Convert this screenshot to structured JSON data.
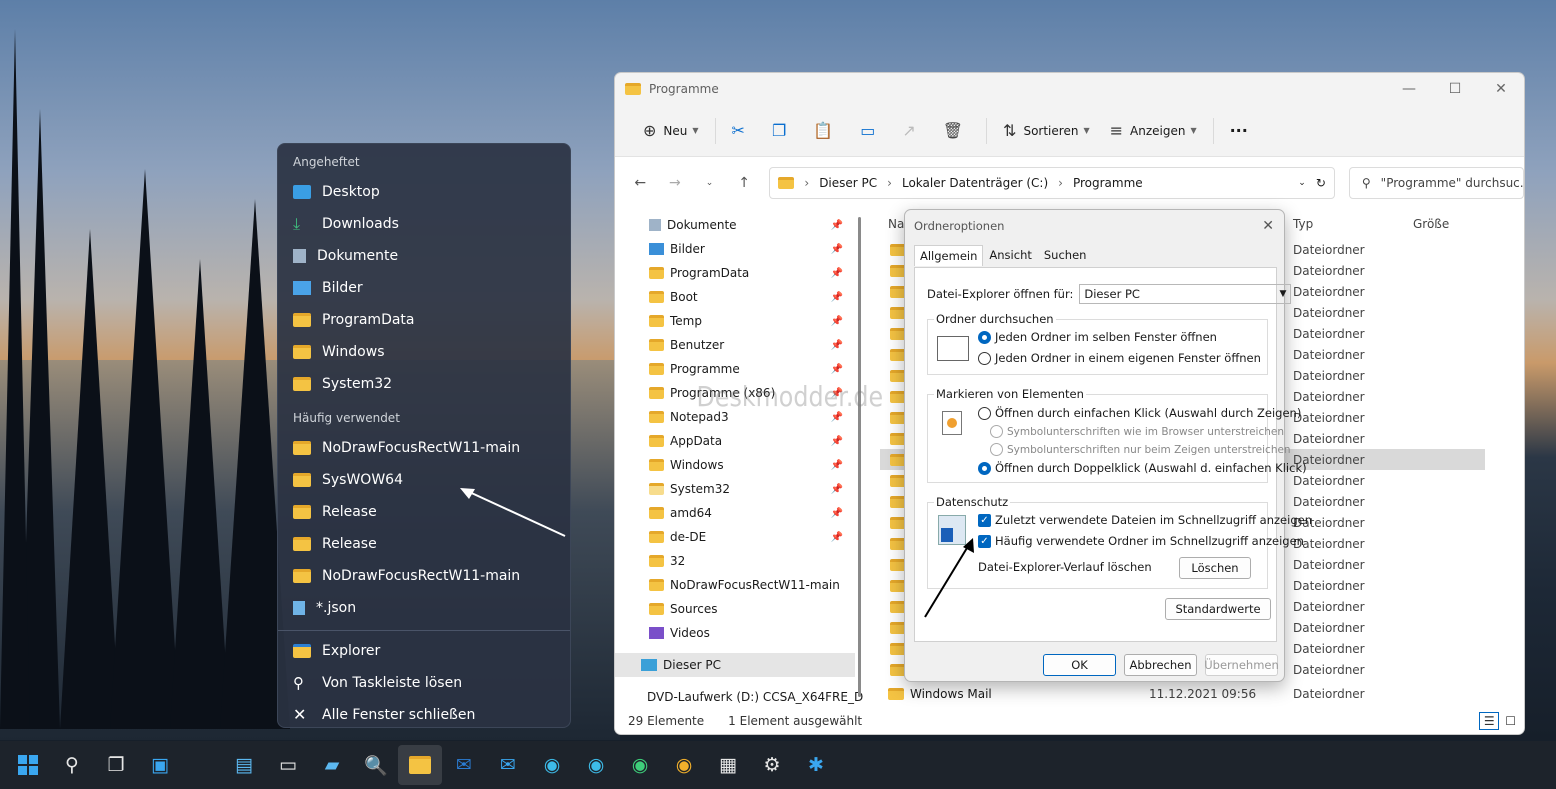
{
  "jumplist": {
    "pinned_header": "Angeheftet",
    "pinned": [
      {
        "label": "Desktop",
        "icon": "desktop-icon"
      },
      {
        "label": "Downloads",
        "icon": "download-icon"
      },
      {
        "label": "Dokumente",
        "icon": "document-icon"
      },
      {
        "label": "Bilder",
        "icon": "picture-icon"
      },
      {
        "label": "ProgramData",
        "icon": "folder-icon"
      },
      {
        "label": "Windows",
        "icon": "folder-icon"
      },
      {
        "label": "System32",
        "icon": "folder-icon"
      }
    ],
    "frequent_header": "Häufig verwendet",
    "frequent": [
      {
        "label": "NoDrawFocusRectW11-main",
        "icon": "folder-icon"
      },
      {
        "label": "SysWOW64",
        "icon": "folder-icon"
      },
      {
        "label": "Release",
        "icon": "folder-icon"
      },
      {
        "label": "Release",
        "icon": "folder-icon"
      },
      {
        "label": "NoDrawFocusRectW11-main",
        "icon": "folder-icon"
      },
      {
        "label": "*.json",
        "icon": "file-icon"
      }
    ],
    "actions": [
      {
        "label": "Explorer",
        "icon": "explorer-icon"
      },
      {
        "label": "Von Taskleiste lösen",
        "icon": "unpin-icon"
      },
      {
        "label": "Alle Fenster schließen",
        "icon": "close-icon"
      }
    ]
  },
  "explorer": {
    "title": "Programme",
    "toolbar": {
      "new": "Neu",
      "sort": "Sortieren",
      "view": "Anzeigen",
      "more": "···"
    },
    "breadcrumb": [
      "Dieser PC",
      "Lokaler Datenträger (C:)",
      "Programme"
    ],
    "search_placeholder": "\"Programme\" durchsuc...",
    "nav": [
      {
        "label": "Dokumente",
        "pinned": true
      },
      {
        "label": "Bilder",
        "pinned": true
      },
      {
        "label": "ProgramData",
        "pinned": true
      },
      {
        "label": "Boot",
        "pinned": true
      },
      {
        "label": "Temp",
        "pinned": true
      },
      {
        "label": "Benutzer",
        "pinned": true
      },
      {
        "label": "Programme",
        "pinned": true
      },
      {
        "label": "Programme (x86)",
        "pinned": true
      },
      {
        "label": "Notepad3",
        "pinned": true
      },
      {
        "label": "AppData",
        "pinned": true
      },
      {
        "label": "Windows",
        "pinned": true
      },
      {
        "label": "System32",
        "pinned": true
      },
      {
        "label": "amd64",
        "pinned": true
      },
      {
        "label": "de-DE",
        "pinned": true
      },
      {
        "label": "32",
        "pinned": false
      },
      {
        "label": "NoDrawFocusRectW11-main",
        "pinned": false
      },
      {
        "label": "Sources",
        "pinned": false
      },
      {
        "label": "Videos",
        "pinned": false
      }
    ],
    "nav_this_pc": "Dieser PC",
    "nav_dvd": "DVD-Laufwerk (D:) CCSA_X64FRE_D",
    "columns": {
      "name": "Nar",
      "type": "Typ",
      "size": "Größe"
    },
    "file_type": "Dateiordner",
    "row_count": 21,
    "last_row": {
      "name": "Windows Mail",
      "date": "11.12.2021 09:56",
      "type": "Dateiordner"
    },
    "status": {
      "count": "29 Elemente",
      "selected": "1 Element ausgewählt"
    }
  },
  "dialog": {
    "title": "Ordneroptionen",
    "tabs": [
      "Allgemein",
      "Ansicht",
      "Suchen"
    ],
    "open_label": "Datei-Explorer öffnen für:",
    "open_value": "Dieser PC",
    "browse": {
      "title": "Ordner durchsuchen",
      "opt1": "Jeden Ordner im selben Fenster öffnen",
      "opt2": "Jeden Ordner in einem eigenen Fenster öffnen"
    },
    "click": {
      "title": "Markieren von Elementen",
      "opt1": "Öffnen durch einfachen Klick (Auswahl durch Zeigen)",
      "sub1": "Symbolunterschriften wie im Browser unterstreichen",
      "sub2": "Symbolunterschriften nur beim Zeigen unterstreichen",
      "opt2": "Öffnen durch Doppelklick (Auswahl d. einfachen Klick)"
    },
    "privacy": {
      "title": "Datenschutz",
      "chk1": "Zuletzt verwendete Dateien im Schnellzugriff anzeigen",
      "chk2": "Häufig verwendete Ordner im Schnellzugriff anzeigen",
      "clear_label": "Datei-Explorer-Verlauf löschen",
      "clear_button": "Löschen"
    },
    "defaults_button": "Standardwerte",
    "ok": "OK",
    "cancel": "Abbrechen",
    "apply": "Übernehmen"
  },
  "watermark": "Deskmodder.de"
}
